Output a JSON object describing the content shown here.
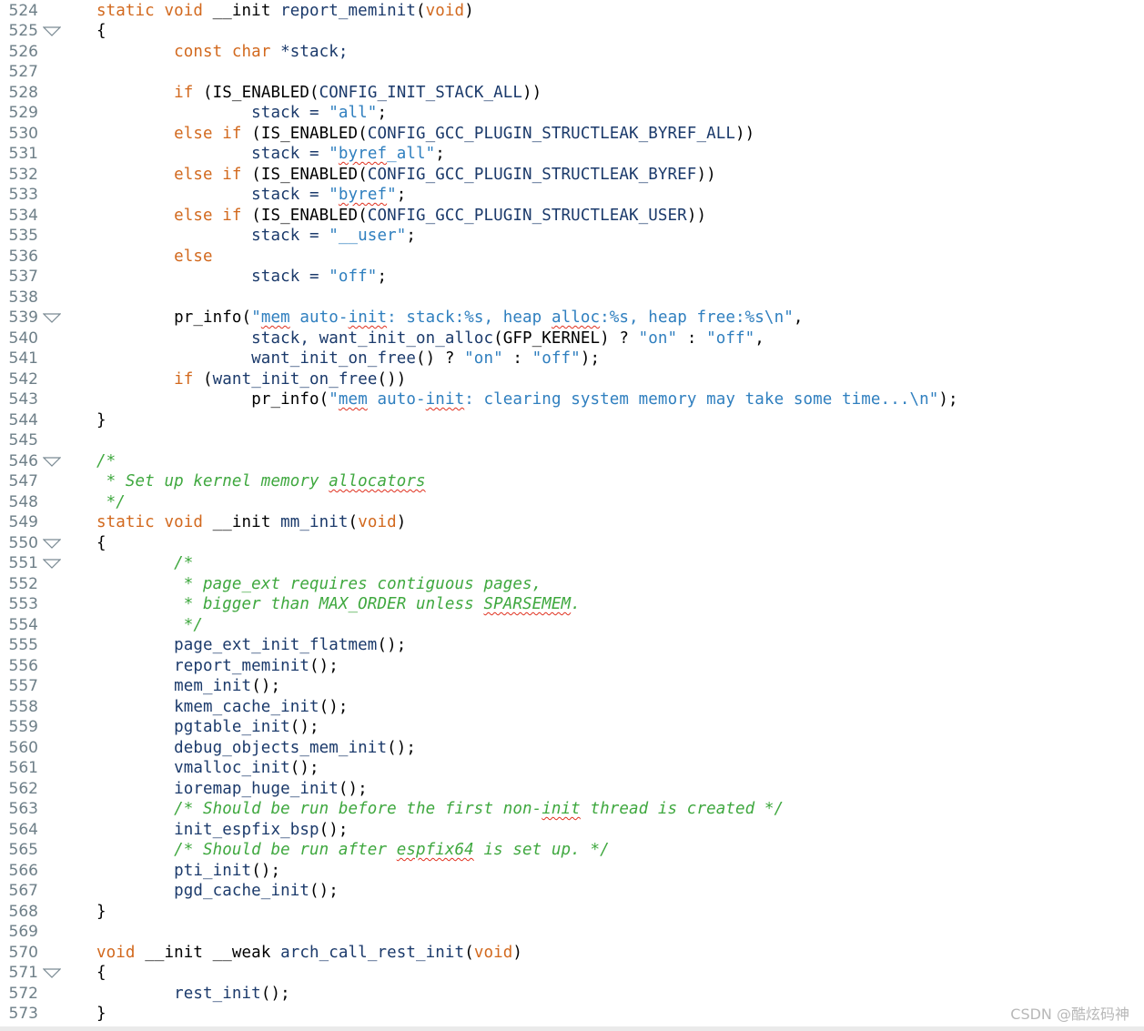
{
  "colors": {
    "keyword": "#d2691e",
    "function": "#000000",
    "string": "#2f7fbf",
    "comment": "#3fa83f",
    "plain": "#1b3a6b",
    "line_number": "#6e7f88",
    "spellcheck": "#e0301e"
  },
  "icons": {
    "fold": "triangle-down-outline"
  },
  "watermark": "CSDN @酷炫码神",
  "lines": [
    {
      "n": "524",
      "fold": false,
      "tokens": [
        [
          "kw",
          "static void "
        ],
        [
          "fn",
          "__init "
        ],
        [
          "pl",
          "report_meminit"
        ],
        [
          "pu",
          "("
        ],
        [
          "kw",
          "void"
        ],
        [
          "pu",
          ")"
        ]
      ]
    },
    {
      "n": "525",
      "fold": true,
      "tokens": [
        [
          "pu",
          "{"
        ]
      ]
    },
    {
      "n": "526",
      "fold": false,
      "tokens": [
        [
          "pl",
          "        "
        ],
        [
          "kw",
          "const char "
        ],
        [
          "pl",
          "*stack;"
        ]
      ]
    },
    {
      "n": "527",
      "fold": false,
      "tokens": []
    },
    {
      "n": "528",
      "fold": false,
      "tokens": [
        [
          "pl",
          "        "
        ],
        [
          "kw",
          "if "
        ],
        [
          "pu",
          "("
        ],
        [
          "fn",
          "IS_ENABLED"
        ],
        [
          "pu",
          "("
        ],
        [
          "pl",
          "CONFIG_INIT_STACK_ALL"
        ],
        [
          "pu",
          "))"
        ]
      ]
    },
    {
      "n": "529",
      "fold": false,
      "tokens": [
        [
          "pl",
          "                stack = "
        ],
        [
          "str",
          "\"all\""
        ],
        [
          "pu",
          ";"
        ]
      ]
    },
    {
      "n": "530",
      "fold": false,
      "tokens": [
        [
          "pl",
          "        "
        ],
        [
          "kw",
          "else if "
        ],
        [
          "pu",
          "("
        ],
        [
          "fn",
          "IS_ENABLED"
        ],
        [
          "pu",
          "("
        ],
        [
          "pl",
          "CONFIG_GCC_PLUGIN_STRUCTLEAK_BYREF_ALL"
        ],
        [
          "pu",
          "))"
        ]
      ]
    },
    {
      "n": "531",
      "fold": false,
      "tokens": [
        [
          "pl",
          "                stack = "
        ],
        [
          "str",
          "\""
        ],
        [
          "str spell",
          "byref"
        ],
        [
          "str",
          "_all\""
        ],
        [
          "pu",
          ";"
        ]
      ]
    },
    {
      "n": "532",
      "fold": false,
      "tokens": [
        [
          "pl",
          "        "
        ],
        [
          "kw",
          "else if "
        ],
        [
          "pu",
          "("
        ],
        [
          "fn",
          "IS_ENABLED"
        ],
        [
          "pu",
          "("
        ],
        [
          "pl",
          "CONFIG_GCC_PLUGIN_STRUCTLEAK_BYREF"
        ],
        [
          "pu",
          "))"
        ]
      ]
    },
    {
      "n": "533",
      "fold": false,
      "tokens": [
        [
          "pl",
          "                stack = "
        ],
        [
          "str",
          "\""
        ],
        [
          "str spell",
          "byref"
        ],
        [
          "str",
          "\""
        ],
        [
          "pu",
          ";"
        ]
      ]
    },
    {
      "n": "534",
      "fold": false,
      "tokens": [
        [
          "pl",
          "        "
        ],
        [
          "kw",
          "else if "
        ],
        [
          "pu",
          "("
        ],
        [
          "fn",
          "IS_ENABLED"
        ],
        [
          "pu",
          "("
        ],
        [
          "pl",
          "CONFIG_GCC_PLUGIN_STRUCTLEAK_USER"
        ],
        [
          "pu",
          "))"
        ]
      ]
    },
    {
      "n": "535",
      "fold": false,
      "tokens": [
        [
          "pl",
          "                stack = "
        ],
        [
          "str",
          "\"__user\""
        ],
        [
          "pu",
          ";"
        ]
      ]
    },
    {
      "n": "536",
      "fold": false,
      "tokens": [
        [
          "pl",
          "        "
        ],
        [
          "kw",
          "else"
        ]
      ]
    },
    {
      "n": "537",
      "fold": false,
      "tokens": [
        [
          "pl",
          "                stack = "
        ],
        [
          "str",
          "\"off\""
        ],
        [
          "pu",
          ";"
        ]
      ]
    },
    {
      "n": "538",
      "fold": false,
      "tokens": []
    },
    {
      "n": "539",
      "fold": true,
      "tokens": [
        [
          "pl",
          "        "
        ],
        [
          "fn",
          "pr_info"
        ],
        [
          "pu",
          "("
        ],
        [
          "str",
          "\""
        ],
        [
          "str spell",
          "mem"
        ],
        [
          "str",
          " auto-"
        ],
        [
          "str spell",
          "init"
        ],
        [
          "str",
          ": stack:%s, heap "
        ],
        [
          "str spell",
          "alloc"
        ],
        [
          "str",
          ":%s, heap free:%s\\n\""
        ],
        [
          "pu",
          ","
        ]
      ]
    },
    {
      "n": "540",
      "fold": false,
      "tokens": [
        [
          "pl",
          "                stack, "
        ],
        [
          "pl",
          "want_init_on_alloc"
        ],
        [
          "pu",
          "("
        ],
        [
          "fn",
          "GFP_KERNEL"
        ],
        [
          "pu",
          ") ? "
        ],
        [
          "str",
          "\"on\""
        ],
        [
          "pu",
          " : "
        ],
        [
          "str",
          "\"off\""
        ],
        [
          "pu",
          ","
        ]
      ]
    },
    {
      "n": "541",
      "fold": false,
      "tokens": [
        [
          "pl",
          "                want_init_on_free"
        ],
        [
          "pu",
          "() ? "
        ],
        [
          "str",
          "\"on\""
        ],
        [
          "pu",
          " : "
        ],
        [
          "str",
          "\"off\""
        ],
        [
          "pu",
          ");"
        ]
      ]
    },
    {
      "n": "542",
      "fold": false,
      "tokens": [
        [
          "pl",
          "        "
        ],
        [
          "kw",
          "if "
        ],
        [
          "pu",
          "("
        ],
        [
          "pl",
          "want_init_on_free"
        ],
        [
          "pu",
          "())"
        ]
      ]
    },
    {
      "n": "543",
      "fold": false,
      "tokens": [
        [
          "pl",
          "                "
        ],
        [
          "fn",
          "pr_info"
        ],
        [
          "pu",
          "("
        ],
        [
          "str",
          "\""
        ],
        [
          "str spell",
          "mem"
        ],
        [
          "str",
          " auto-"
        ],
        [
          "str spell",
          "init"
        ],
        [
          "str",
          ": clearing system memory may take some time...\\n\""
        ],
        [
          "pu",
          ");"
        ]
      ]
    },
    {
      "n": "544",
      "fold": false,
      "tokens": [
        [
          "pu",
          "}"
        ]
      ]
    },
    {
      "n": "545",
      "fold": false,
      "tokens": []
    },
    {
      "n": "546",
      "fold": true,
      "tokens": [
        [
          "cmt",
          "/*"
        ]
      ]
    },
    {
      "n": "547",
      "fold": false,
      "tokens": [
        [
          "cmt",
          " * Set up kernel memory "
        ],
        [
          "cmt spell",
          "allocators"
        ]
      ]
    },
    {
      "n": "548",
      "fold": false,
      "tokens": [
        [
          "cmt",
          " */"
        ]
      ]
    },
    {
      "n": "549",
      "fold": false,
      "tokens": [
        [
          "kw",
          "static void "
        ],
        [
          "fn",
          "__init "
        ],
        [
          "pl",
          "mm_init"
        ],
        [
          "pu",
          "("
        ],
        [
          "kw",
          "void"
        ],
        [
          "pu",
          ")"
        ]
      ]
    },
    {
      "n": "550",
      "fold": true,
      "tokens": [
        [
          "pu",
          "{"
        ]
      ]
    },
    {
      "n": "551",
      "fold": true,
      "tokens": [
        [
          "pl",
          "        "
        ],
        [
          "cmt",
          "/*"
        ]
      ]
    },
    {
      "n": "552",
      "fold": false,
      "tokens": [
        [
          "pl",
          "        "
        ],
        [
          "cmt",
          " * page_ext requires contiguous pages,"
        ]
      ]
    },
    {
      "n": "553",
      "fold": false,
      "tokens": [
        [
          "pl",
          "        "
        ],
        [
          "cmt",
          " * bigger than MAX_ORDER unless "
        ],
        [
          "cmt spell",
          "SPARSEMEM"
        ],
        [
          "cmt",
          "."
        ]
      ]
    },
    {
      "n": "554",
      "fold": false,
      "tokens": [
        [
          "pl",
          "        "
        ],
        [
          "cmt",
          " */"
        ]
      ]
    },
    {
      "n": "555",
      "fold": false,
      "tokens": [
        [
          "pl",
          "        page_ext_init_flatmem"
        ],
        [
          "pu",
          "();"
        ]
      ]
    },
    {
      "n": "556",
      "fold": false,
      "tokens": [
        [
          "pl",
          "        report_meminit"
        ],
        [
          "pu",
          "();"
        ]
      ]
    },
    {
      "n": "557",
      "fold": false,
      "tokens": [
        [
          "pl",
          "        mem_init"
        ],
        [
          "pu",
          "();"
        ]
      ]
    },
    {
      "n": "558",
      "fold": false,
      "tokens": [
        [
          "pl",
          "        kmem_cache_init"
        ],
        [
          "pu",
          "();"
        ]
      ]
    },
    {
      "n": "559",
      "fold": false,
      "tokens": [
        [
          "pl",
          "        pgtable_init"
        ],
        [
          "pu",
          "();"
        ]
      ]
    },
    {
      "n": "560",
      "fold": false,
      "tokens": [
        [
          "pl",
          "        debug_objects_mem_init"
        ],
        [
          "pu",
          "();"
        ]
      ]
    },
    {
      "n": "561",
      "fold": false,
      "tokens": [
        [
          "pl",
          "        vmalloc_init"
        ],
        [
          "pu",
          "();"
        ]
      ]
    },
    {
      "n": "562",
      "fold": false,
      "tokens": [
        [
          "pl",
          "        ioremap_huge_init"
        ],
        [
          "pu",
          "();"
        ]
      ]
    },
    {
      "n": "563",
      "fold": false,
      "tokens": [
        [
          "pl",
          "        "
        ],
        [
          "cmt",
          "/* Should be run before the first non-"
        ],
        [
          "cmt spell",
          "init"
        ],
        [
          "cmt",
          " thread is created */"
        ]
      ]
    },
    {
      "n": "564",
      "fold": false,
      "tokens": [
        [
          "pl",
          "        init_espfix_bsp"
        ],
        [
          "pu",
          "();"
        ]
      ]
    },
    {
      "n": "565",
      "fold": false,
      "tokens": [
        [
          "pl",
          "        "
        ],
        [
          "cmt",
          "/* Should be run after "
        ],
        [
          "cmt spell",
          "espfix64"
        ],
        [
          "cmt",
          " is set up. */"
        ]
      ]
    },
    {
      "n": "566",
      "fold": false,
      "tokens": [
        [
          "pl",
          "        pti_init"
        ],
        [
          "pu",
          "();"
        ]
      ]
    },
    {
      "n": "567",
      "fold": false,
      "tokens": [
        [
          "pl",
          "        pgd_cache_init"
        ],
        [
          "pu",
          "();"
        ]
      ]
    },
    {
      "n": "568",
      "fold": false,
      "tokens": [
        [
          "pu",
          "}"
        ]
      ]
    },
    {
      "n": "569",
      "fold": false,
      "tokens": []
    },
    {
      "n": "570",
      "fold": false,
      "tokens": [
        [
          "kw",
          "void "
        ],
        [
          "fn",
          "__init __weak "
        ],
        [
          "pl",
          "arch_call_rest_init"
        ],
        [
          "pu",
          "("
        ],
        [
          "kw",
          "void"
        ],
        [
          "pu",
          ")"
        ]
      ]
    },
    {
      "n": "571",
      "fold": true,
      "tokens": [
        [
          "pu",
          "{"
        ]
      ]
    },
    {
      "n": "572",
      "fold": false,
      "tokens": [
        [
          "pl",
          "        rest_init"
        ],
        [
          "pu",
          "();"
        ]
      ]
    },
    {
      "n": "573",
      "fold": false,
      "tokens": [
        [
          "pu",
          "}"
        ]
      ]
    }
  ]
}
